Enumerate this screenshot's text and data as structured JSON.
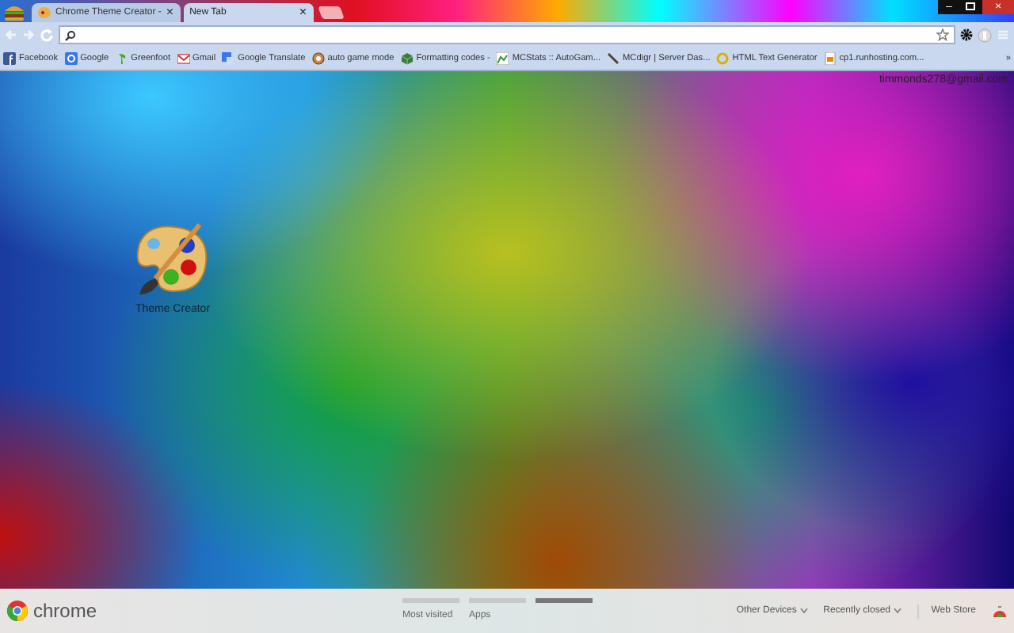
{
  "tabs": [
    {
      "title": "Chrome Theme Creator -",
      "selected": false,
      "close": "×"
    },
    {
      "title": "New Tab",
      "selected": true,
      "close": "×"
    }
  ],
  "window_controls": [
    "–",
    "×"
  ],
  "bookmarks": [
    {
      "label": "Facebook"
    },
    {
      "label": "Google"
    },
    {
      "label": "Greenfoot"
    },
    {
      "label": "Gmail"
    },
    {
      "label": "Google Translate"
    },
    {
      "label": "auto game mode"
    },
    {
      "label": "Formatting codes -"
    },
    {
      "label": "MCStats :: AutoGam..."
    },
    {
      "label": "MCdigr | Server Das..."
    },
    {
      "label": "HTML Text Generator"
    },
    {
      "label": "cp1.runhosting.com..."
    }
  ],
  "bookmarks_overflow": "»",
  "account": "timmonds278@gmail.com",
  "apps": [
    {
      "label": "Theme Creator"
    }
  ],
  "footer": {
    "logo_text": "chrome",
    "pages": [
      {
        "label": "Most visited",
        "selected": false
      },
      {
        "label": "Apps",
        "selected": false
      },
      {
        "selected": true
      }
    ],
    "links": [
      "Other Devices",
      "Recently closed"
    ],
    "web_store": "Web Store"
  }
}
